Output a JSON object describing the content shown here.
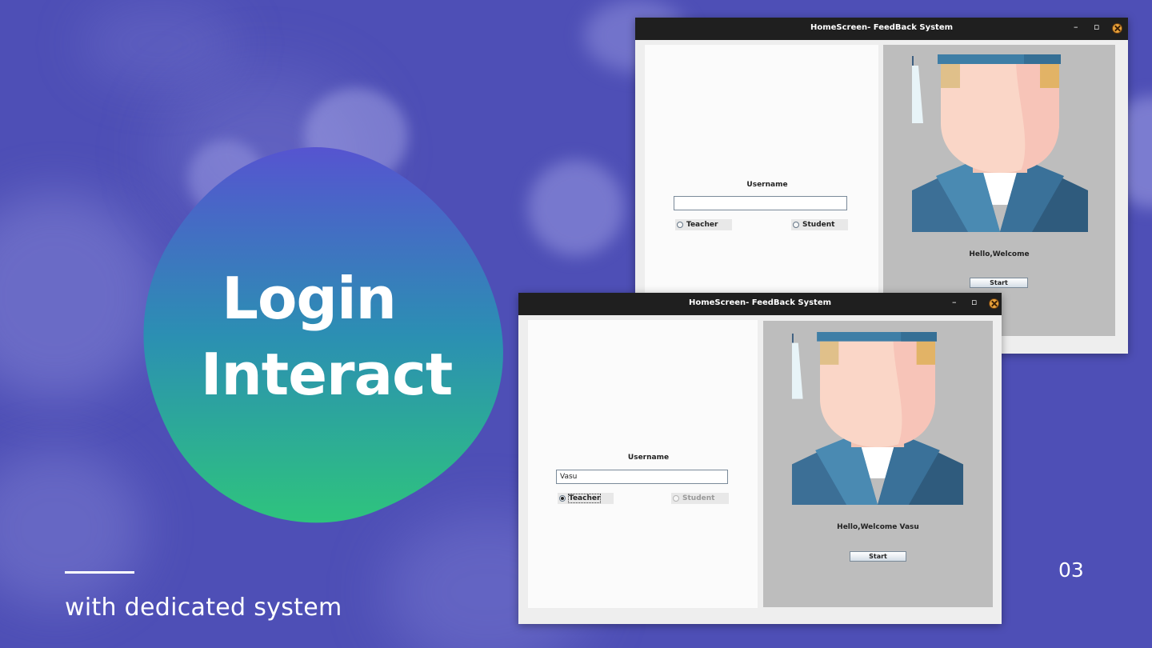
{
  "slide": {
    "headline_line1": "Login",
    "headline_line2": "Interact",
    "subtitle": "with dedicated system",
    "page_number": "03"
  },
  "windows": [
    {
      "title": "HomeScreen- FeedBack System",
      "minimize": "–",
      "maximize": "▫",
      "username_label": "Username",
      "username_value": "",
      "radio_teacher": "Teacher",
      "radio_student": "Student",
      "welcome": "Hello,Welcome",
      "start": "Start"
    },
    {
      "title": "HomeScreen- FeedBack System",
      "minimize": "–",
      "maximize": "▫",
      "username_label": "Username",
      "username_value": "Vasu",
      "radio_teacher": "Teacher",
      "radio_student": "Student",
      "welcome": "Hello,Welcome Vasu",
      "start": "Start"
    }
  ],
  "colors": {
    "background": "#4e4fb6",
    "blob_top": "#5654d0",
    "blob_mid": "#2b8fb3",
    "blob_bottom": "#2ec47d",
    "avatar_hat": "#3e7ea6",
    "avatar_skin": "#fad6c7",
    "avatar_jacket": "#3c6f96"
  }
}
